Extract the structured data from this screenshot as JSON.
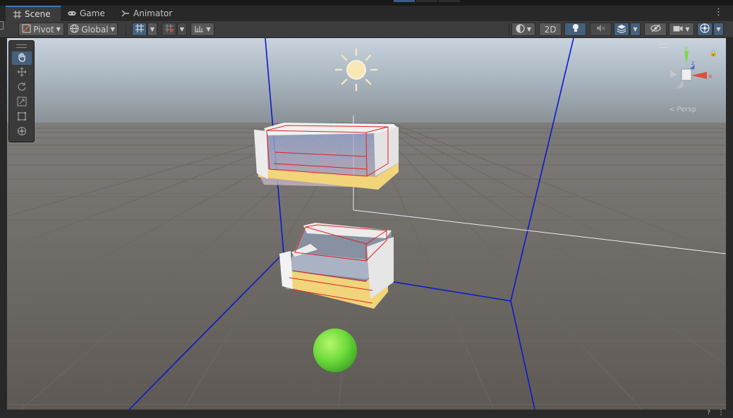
{
  "tabs": [
    {
      "label": "Scene",
      "icon": "grid-icon",
      "active": true
    },
    {
      "label": "Game",
      "icon": "gamepad-icon",
      "active": false
    },
    {
      "label": "Animator",
      "icon": "animator-icon",
      "active": false
    }
  ],
  "toolbar": {
    "pivot_label": "Pivot",
    "global_label": "Global",
    "twod_label": "2D"
  },
  "tools": [
    {
      "name": "hand-tool",
      "icon": "hand-icon",
      "active": true
    },
    {
      "name": "move-tool",
      "icon": "move-icon",
      "active": false
    },
    {
      "name": "rotate-tool",
      "icon": "rotate-icon",
      "active": false
    },
    {
      "name": "scale-tool",
      "icon": "scale-icon",
      "active": false
    },
    {
      "name": "rect-tool",
      "icon": "rect-icon",
      "active": false
    },
    {
      "name": "transform-tool",
      "icon": "transform-icon",
      "active": false
    }
  ],
  "gizmo": {
    "y": "y",
    "x": "x",
    "z": "z",
    "back": "< Persp"
  },
  "colors": {
    "accent": "#46607c",
    "active_tab_border": "#3a79bb",
    "ground": "#5e5954",
    "sky": "#8b9aa6",
    "boundary_lines": "#0a1acc",
    "selection_outline": "#e02020",
    "sphere": "#6fdc3c",
    "floor_tile": "#f2d47a"
  }
}
